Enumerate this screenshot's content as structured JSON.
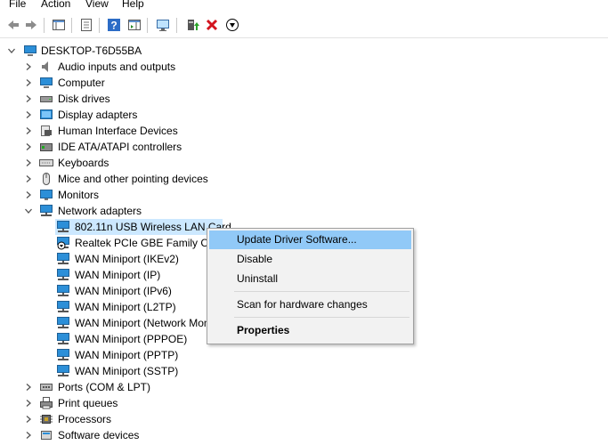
{
  "menu": [
    "File",
    "Action",
    "View",
    "Help"
  ],
  "toolbar": {
    "icons": [
      "back-arrow-icon",
      "forward-arrow-icon",
      "show-hide-tree-icon",
      "properties-icon",
      "help-icon",
      "action-pane-icon",
      "monitor-icon",
      "update-driver-icon",
      "uninstall-icon",
      "disable-device-icon"
    ]
  },
  "tree": {
    "root": "DESKTOP-T6D55BA",
    "categories": [
      "Audio inputs and outputs",
      "Computer",
      "Disk drives",
      "Display adapters",
      "Human Interface Devices",
      "IDE ATA/ATAPI controllers",
      "Keyboards",
      "Mice and other pointing devices",
      "Monitors",
      "Network adapters"
    ],
    "network_children": [
      "802.11n USB Wireless LAN Card",
      "Realtek PCIe GBE Family Controller",
      "WAN Miniport (IKEv2)",
      "WAN Miniport (IP)",
      "WAN Miniport (IPv6)",
      "WAN Miniport (L2TP)",
      "WAN Miniport (Network Monitor)",
      "WAN Miniport (PPPOE)",
      "WAN Miniport (PPTP)",
      "WAN Miniport (SSTP)"
    ],
    "after": [
      "Ports (COM & LPT)",
      "Print queues",
      "Processors",
      "Software devices"
    ]
  },
  "context_menu": {
    "update": "Update Driver Software...",
    "disable": "Disable",
    "uninstall": "Uninstall",
    "scan": "Scan for hardware changes",
    "properties": "Properties"
  },
  "colors": {
    "selection": "#cce8ff",
    "menu_highlight": "#91c9f7",
    "menu_bg": "#f2f2f2"
  }
}
